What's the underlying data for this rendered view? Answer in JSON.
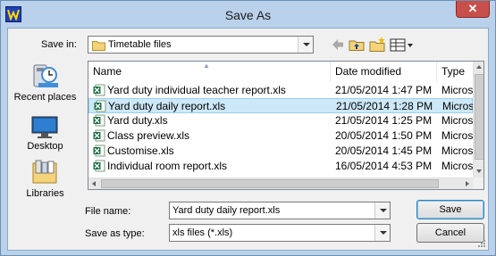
{
  "window": {
    "title": "Save As",
    "close_symbol": "✕"
  },
  "toolbar": {
    "save_in_label": "Save in:",
    "save_in_value": "Timetable files",
    "icons": [
      "back-arrow-icon",
      "up-folder-icon",
      "new-folder-icon",
      "view-menu-icon"
    ]
  },
  "places": [
    {
      "label": "Recent places",
      "icon": "recent-places-icon"
    },
    {
      "label": "Desktop",
      "icon": "desktop-icon"
    },
    {
      "label": "Libraries",
      "icon": "libraries-icon"
    }
  ],
  "file_list": {
    "columns": [
      "Name",
      "Date modified",
      "Type"
    ],
    "rows": [
      {
        "name": "Yard duty individual teacher report.xls",
        "date": "21/05/2014 1:47 PM",
        "type": "Micros",
        "selected": false
      },
      {
        "name": "Yard duty daily report.xls",
        "date": "21/05/2014 1:28 PM",
        "type": "Micros",
        "selected": true
      },
      {
        "name": "Yard duty.xls",
        "date": "21/05/2014 1:25 PM",
        "type": "Micros",
        "selected": false
      },
      {
        "name": "Class preview.xls",
        "date": "20/05/2014 1:50 PM",
        "type": "Micros",
        "selected": false
      },
      {
        "name": "Customise.xls",
        "date": "20/05/2014 1:45 PM",
        "type": "Micros",
        "selected": false
      },
      {
        "name": "Individual room report.xls",
        "date": "16/05/2014 4:53 PM",
        "type": "Micros",
        "selected": false
      }
    ]
  },
  "form": {
    "file_name_label": "File name:",
    "file_name_value": "Yard duty daily report.xls",
    "save_type_label": "Save as type:",
    "save_type_value": "xls files (*.xls)"
  },
  "buttons": {
    "save": "Save",
    "cancel": "Cancel"
  },
  "colors": {
    "frame": "#b9d1ea",
    "close": "#c7504a",
    "selection": "#cde8f7",
    "excel_green": "#1d7044"
  }
}
